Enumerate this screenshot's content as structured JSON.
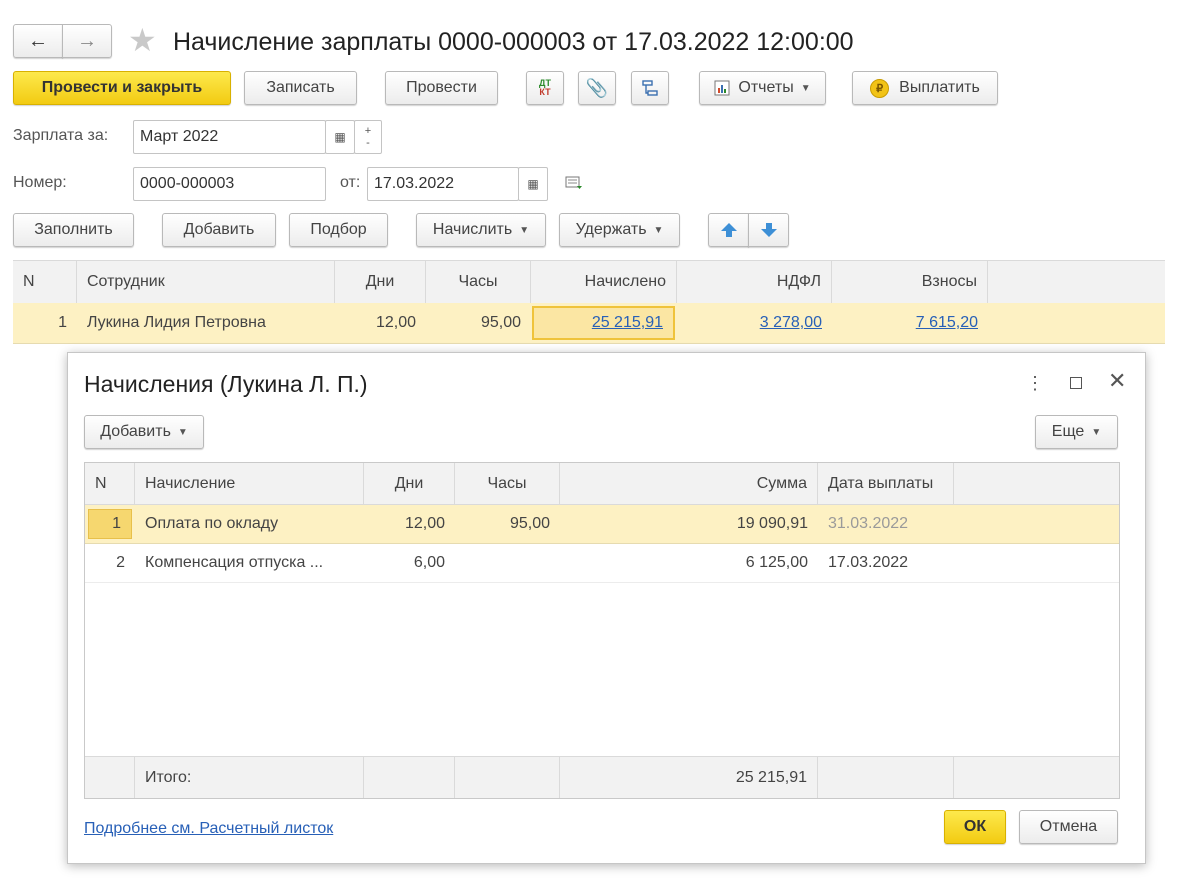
{
  "title": "Начисление зарплаты 0000-000003 от 17.03.2022 12:00:00",
  "toolbar": {
    "post_close": "Провести и закрыть",
    "save": "Записать",
    "post": "Провести",
    "dtkt": "ДТ КТ",
    "reports": "Отчеты",
    "pay": "Выплатить"
  },
  "form": {
    "salary_label": "Зарплата за:",
    "salary_value": "Март 2022",
    "number_label": "Номер:",
    "number_value": "0000-000003",
    "date_label": "от:",
    "date_value": "17.03.2022"
  },
  "table_toolbar": {
    "fill": "Заполнить",
    "add": "Добавить",
    "select": "Подбор",
    "accrue": "Начислить",
    "withhold": "Удержать"
  },
  "main_table": {
    "headers": [
      "N",
      "Сотрудник",
      "Дни",
      "Часы",
      "Начислено",
      "НДФЛ",
      "Взносы"
    ],
    "rows": [
      [
        "1",
        "Лукина Лидия Петровна",
        "12,00",
        "95,00",
        "25 215,91",
        "3 278,00",
        "7 615,20"
      ]
    ]
  },
  "dialog": {
    "title": "Начисления (Лукина Л. П.)",
    "add": "Добавить",
    "more": "Еще",
    "headers": [
      "N",
      "Начисление",
      "Дни",
      "Часы",
      "Сумма",
      "Дата выплаты"
    ],
    "rows": [
      [
        "1",
        "Оплата по окладу",
        "12,00",
        "95,00",
        "19 090,91",
        "31.03.2022"
      ],
      [
        "2",
        "Компенсация отпуска ...",
        "6,00",
        "",
        "6 125,00",
        "17.03.2022"
      ]
    ],
    "total_label": "Итого:",
    "total_value": "25 215,91",
    "link": "Подробнее см. Расчетный листок",
    "ok": "ОК",
    "cancel": "Отмена"
  },
  "colors": {
    "accent_yellow": "#f5d321",
    "selected_row": "#fdf1c3",
    "link_blue": "#2860b7"
  }
}
